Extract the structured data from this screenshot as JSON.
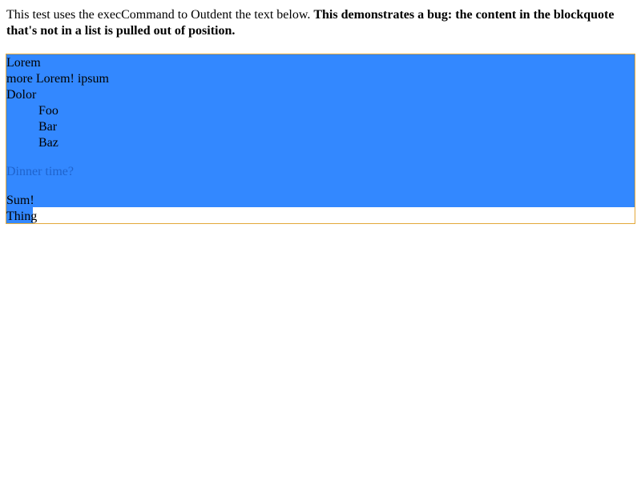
{
  "intro": {
    "normal": "This test uses the execCommand to Outdent the text below. ",
    "bold": "This demonstrates a bug: the content in the blockquote that's not in a list is pulled out of position."
  },
  "editor": {
    "lines": {
      "lorem": "Lorem",
      "more": "more Lorem! ipsum",
      "dolor": "Dolor",
      "foo": "Foo",
      "bar": "Bar",
      "baz": "Baz",
      "dinner": "Dinner time?",
      "sum": "Sum!",
      "thing": "Thing"
    }
  },
  "colors": {
    "selection": "#3388ff",
    "border": "#e3a83a",
    "quote_text": "#1f63cc"
  }
}
